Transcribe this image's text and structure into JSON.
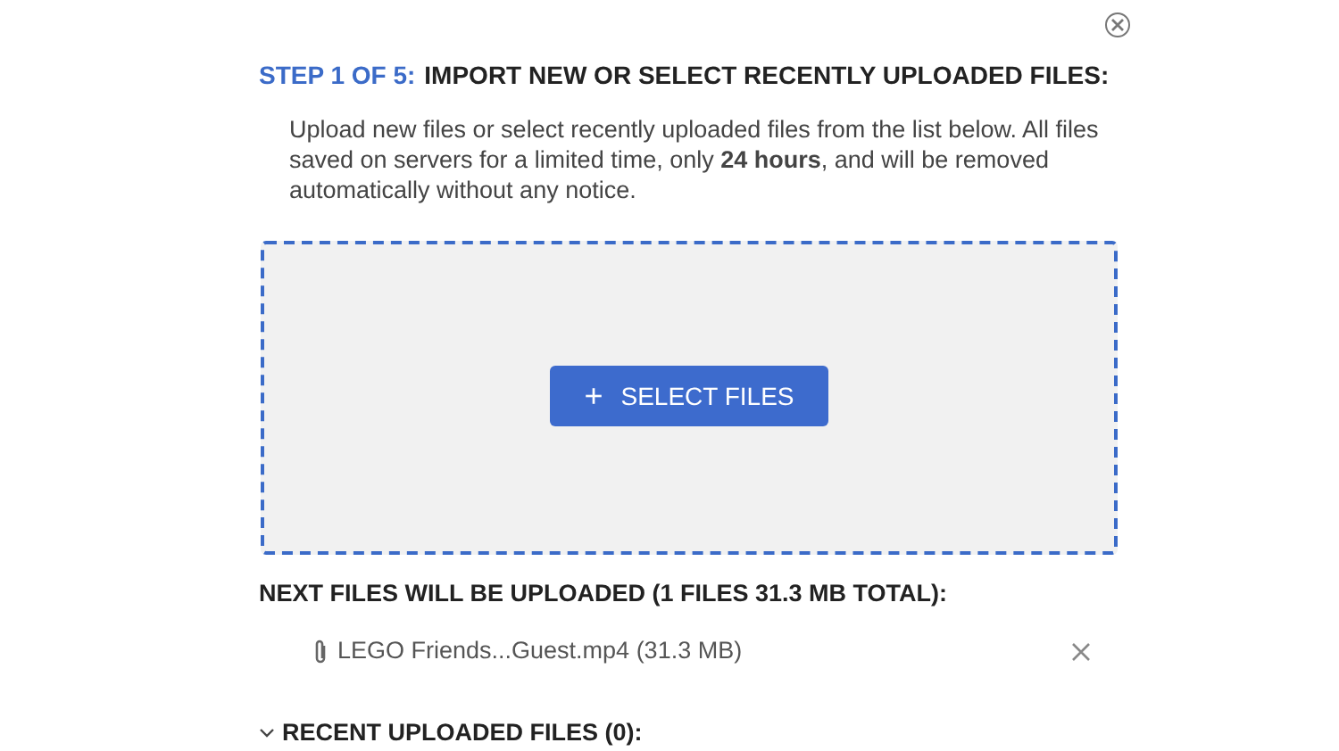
{
  "step_label": "STEP 1 OF 5:",
  "title": "IMPORT NEW OR SELECT RECENTLY UPLOADED FILES:",
  "description": "Upload new files or select recently uploaded files from the list below. All files saved on servers for a limited time, only **24 hours**, and will be removed automatically without any notice.",
  "drop_zone": {
    "button": "SELECT FILES",
    "button_icon": "+"
  },
  "next_files": {
    "heading": "NEXT FILES WILL BE UPLOADED (1 FILES 31.3 MB TOTAL):",
    "files": [
      {
        "name": "LEGO Friends...Guest.mp4 (31.3 MB)"
      }
    ]
  },
  "recent": {
    "heading": "RECENT UPLOADED FILES (0):",
    "expanded": true
  }
}
